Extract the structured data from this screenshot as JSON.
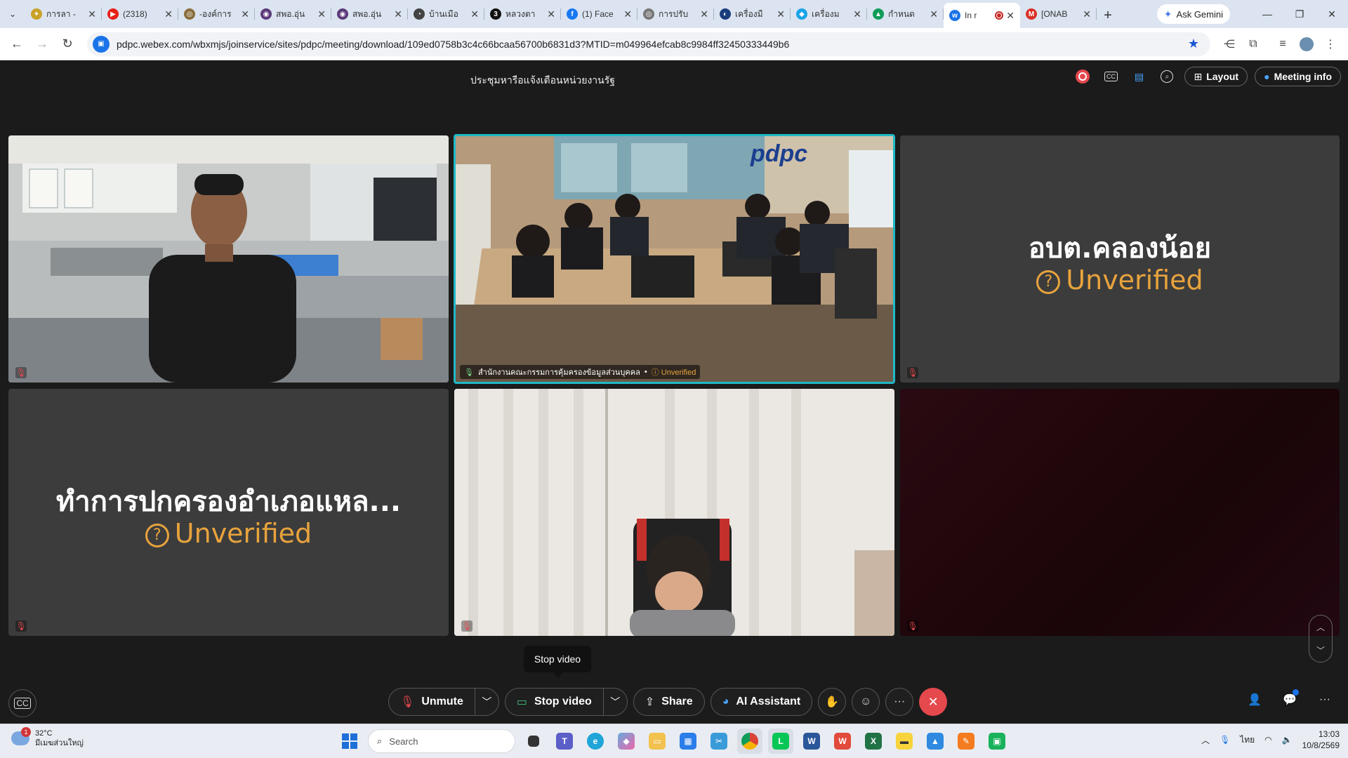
{
  "browser": {
    "tabs": [
      {
        "title": "การลา -",
        "color": "#c9a227",
        "glyph": "✦"
      },
      {
        "title": "(2318)",
        "color": "#e62117",
        "glyph": "▶"
      },
      {
        "title": "-องค์การ",
        "color": "#8a6d3b",
        "glyph": "◎"
      },
      {
        "title": "สพอ.อุ่น",
        "color": "#5b3a7a",
        "glyph": "◉"
      },
      {
        "title": "สพอ.อุ่น",
        "color": "#5b3a7a",
        "glyph": "◉"
      },
      {
        "title": "บ้านเมือ",
        "color": "#444444",
        "glyph": "◔"
      },
      {
        "title": "หลวงตา",
        "color": "#111111",
        "glyph": "3"
      },
      {
        "title": "(1) Face",
        "color": "#1877f2",
        "glyph": "f"
      },
      {
        "title": "การปรับ",
        "color": "#777777",
        "glyph": "◎"
      },
      {
        "title": "เครื่องมื",
        "color": "#1a3d7c",
        "glyph": "◐"
      },
      {
        "title": "เครื่องม",
        "color": "#1aa3e8",
        "glyph": "◆"
      },
      {
        "title": "กำหนด",
        "color": "#0f9d58",
        "glyph": "▲"
      },
      {
        "title": "In r",
        "color": "#1a73e8",
        "glyph": "w",
        "active": true
      },
      {
        "title": "[ONAB",
        "color": "#d93025",
        "glyph": "M"
      }
    ],
    "new_tab": "+",
    "ask_gemini": "Ask Gemini",
    "url": "pdpc.webex.com/wbxmjs/joinservice/sites/pdpc/meeting/download/109ed0758b3c4c66bcaa56700b6831d3?MTID=m049964efcab8c9984ff32450333449b6"
  },
  "meeting": {
    "title": "ประชุมหารือแจ้งเตือนหน่วยงานรัฐ",
    "layout_label": "Layout",
    "meeting_info_label": "Meeting info",
    "tiles": {
      "t3_name": "อบต.คลองน้อย",
      "t4_name": "ทำการปกครองอำเภอแหล...",
      "unverified": "Unverified",
      "t2_name": "สำนักงานคณะกรรมการคุ้มครองข้อมูลส่วนบุคคล",
      "t2_sep": "•",
      "pdpc_logo": "pdpc"
    },
    "tooltip": "Stop video",
    "controls": {
      "unmute": "Unmute",
      "stop_video": "Stop video",
      "share": "Share",
      "ai_assistant": "AI Assistant",
      "more": "···"
    }
  },
  "taskbar": {
    "weather_temp": "32°C",
    "weather_desc": "มีเมฆส่วนใหญ่",
    "weather_badge": "1",
    "search_placeholder": "Search",
    "lang": "ไทย",
    "time": "13:03",
    "date": "10/8/2569"
  },
  "colors": {
    "accent_unverified": "#e8a33d",
    "active_speaker_border": "#1fb8c7",
    "end_call": "#e5484d"
  }
}
